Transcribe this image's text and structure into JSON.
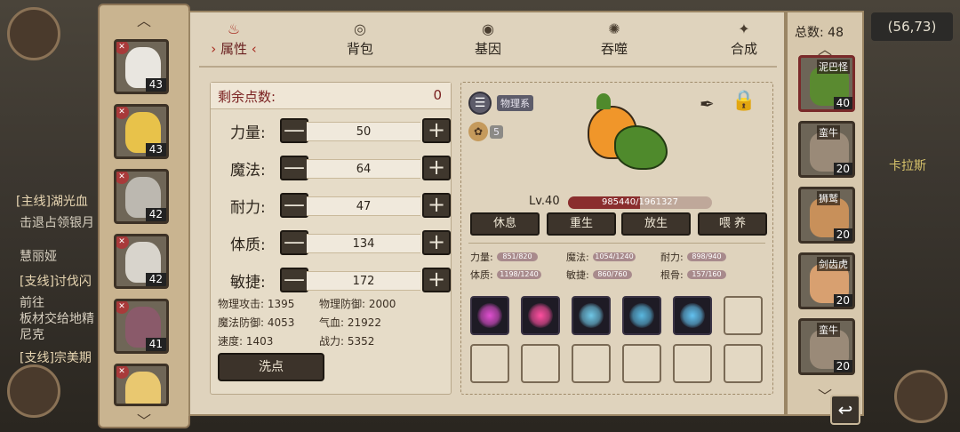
{
  "coords": "(56,73)",
  "background_quests": {
    "quest1_title": "[主线]湖光血",
    "quest1_desc_a": "击退占领银月",
    "quest1_desc_b": "慧丽娅",
    "quest2_title": "[支线]讨伐闪",
    "quest2_desc_a": "前往",
    "quest2_desc_b": "板材交给地精",
    "quest2_desc_c": "尼克",
    "quest3_title": "[支线]宗美期",
    "npc_text": "卡拉斯"
  },
  "heroes": [
    {
      "level": "43",
      "badge": "✕"
    },
    {
      "level": "43",
      "badge": "✕"
    },
    {
      "level": "42",
      "badge": "✕"
    },
    {
      "level": "42",
      "badge": "✕"
    },
    {
      "level": "41",
      "badge": "✕"
    },
    {
      "level": "",
      "badge": "✕"
    }
  ],
  "tabs": [
    {
      "label": "属性",
      "icon": "flame-icon",
      "active": true
    },
    {
      "label": "背包",
      "icon": "bag-icon",
      "active": false
    },
    {
      "label": "基因",
      "icon": "eye-icon",
      "active": false
    },
    {
      "label": "吞噬",
      "icon": "swirl-icon",
      "active": false
    },
    {
      "label": "合成",
      "icon": "anvil-icon",
      "active": false
    }
  ],
  "tab_arrows": {
    "left": "›",
    "right": "‹"
  },
  "points": {
    "label": "剩余点数:",
    "value": "0"
  },
  "stats": [
    {
      "label": "力量:",
      "value": "50"
    },
    {
      "label": "魔法:",
      "value": "64"
    },
    {
      "label": "耐力:",
      "value": "47"
    },
    {
      "label": "体质:",
      "value": "134"
    },
    {
      "label": "敏捷:",
      "value": "172"
    }
  ],
  "stepper_symbols": {
    "minus": "—",
    "plus": "+"
  },
  "derived": {
    "phys_atk": "物理攻击: 1395",
    "phys_def": "物理防御: 2000",
    "mag_def": "魔法防御: 4053",
    "hp": "气血: 21922",
    "speed": "速度: 1403",
    "power": "战力: 5352"
  },
  "wash_button": "洗点",
  "pet": {
    "type_chip": "物理系",
    "paw_count": "5",
    "level": "Lv.40",
    "exp": "985440/1961327",
    "exp_fraction": 0.502
  },
  "actions": [
    "休息",
    "重生",
    "放生",
    "喂 养"
  ],
  "growth": [
    {
      "label": "力量:",
      "value": "851/820"
    },
    {
      "label": "魔法:",
      "value": "1054/1240"
    },
    {
      "label": "耐力:",
      "value": "898/940"
    },
    {
      "label": "体质:",
      "value": "1198/1240"
    },
    {
      "label": "敏捷:",
      "value": "860/760"
    },
    {
      "label": "根骨:",
      "value": "157/160"
    }
  ],
  "skills": [
    {
      "name": "pink-beast-skill-icon",
      "color": "#e04fd0"
    },
    {
      "name": "pink-vortex-skill-icon",
      "color": "#ff4fa0"
    },
    {
      "name": "ice-shard-skill-icon",
      "color": "#6fc7e6"
    },
    {
      "name": "ice-orb-skill-icon",
      "color": "#5ab8e0"
    },
    {
      "name": "water-wave-skill-icon",
      "color": "#63c2f0"
    }
  ],
  "pet_list": {
    "total_label": "总数: 48",
    "pets": [
      {
        "name": "泥巴怪",
        "level": "40",
        "selected": true
      },
      {
        "name": "蛮牛",
        "level": "20",
        "selected": false
      },
      {
        "name": "狮鹫",
        "level": "20",
        "selected": false
      },
      {
        "name": "剑齿虎",
        "level": "20",
        "selected": false
      },
      {
        "name": "蛮牛",
        "level": "20",
        "selected": false
      }
    ]
  }
}
